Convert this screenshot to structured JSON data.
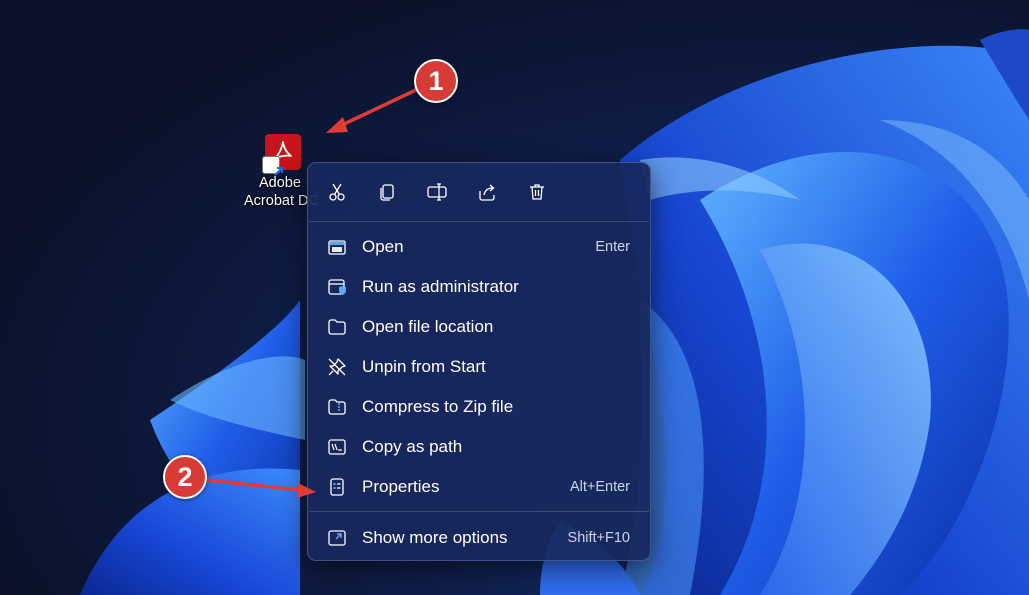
{
  "desktop": {
    "icon_label_line1": "Adobe",
    "icon_label_line2": "Acrobat DC"
  },
  "context_menu": {
    "toolbar": [
      {
        "name": "cut-icon"
      },
      {
        "name": "copy-icon"
      },
      {
        "name": "rename-icon"
      },
      {
        "name": "share-icon"
      },
      {
        "name": "delete-icon"
      }
    ],
    "items": [
      {
        "label": "Open",
        "shortcut": "Enter",
        "icon": "open-window-icon"
      },
      {
        "label": "Run as administrator",
        "shortcut": "",
        "icon": "shield-window-icon"
      },
      {
        "label": "Open file location",
        "shortcut": "",
        "icon": "folder-icon"
      },
      {
        "label": "Unpin from Start",
        "shortcut": "",
        "icon": "unpin-icon"
      },
      {
        "label": "Compress to Zip file",
        "shortcut": "",
        "icon": "zip-folder-icon"
      },
      {
        "label": "Copy as path",
        "shortcut": "",
        "icon": "copy-path-icon"
      },
      {
        "label": "Properties",
        "shortcut": "Alt+Enter",
        "icon": "properties-icon"
      },
      {
        "label": "Show more options",
        "shortcut": "Shift+F10",
        "icon": "more-options-icon"
      }
    ]
  },
  "annotations": {
    "step1": "1",
    "step2": "2"
  },
  "colors": {
    "badge": "#d83a35",
    "arrow": "#e03b36",
    "menu_bg": "#18285c",
    "accent": "#5aa9f5",
    "acrobat_red": "#c8141a"
  }
}
